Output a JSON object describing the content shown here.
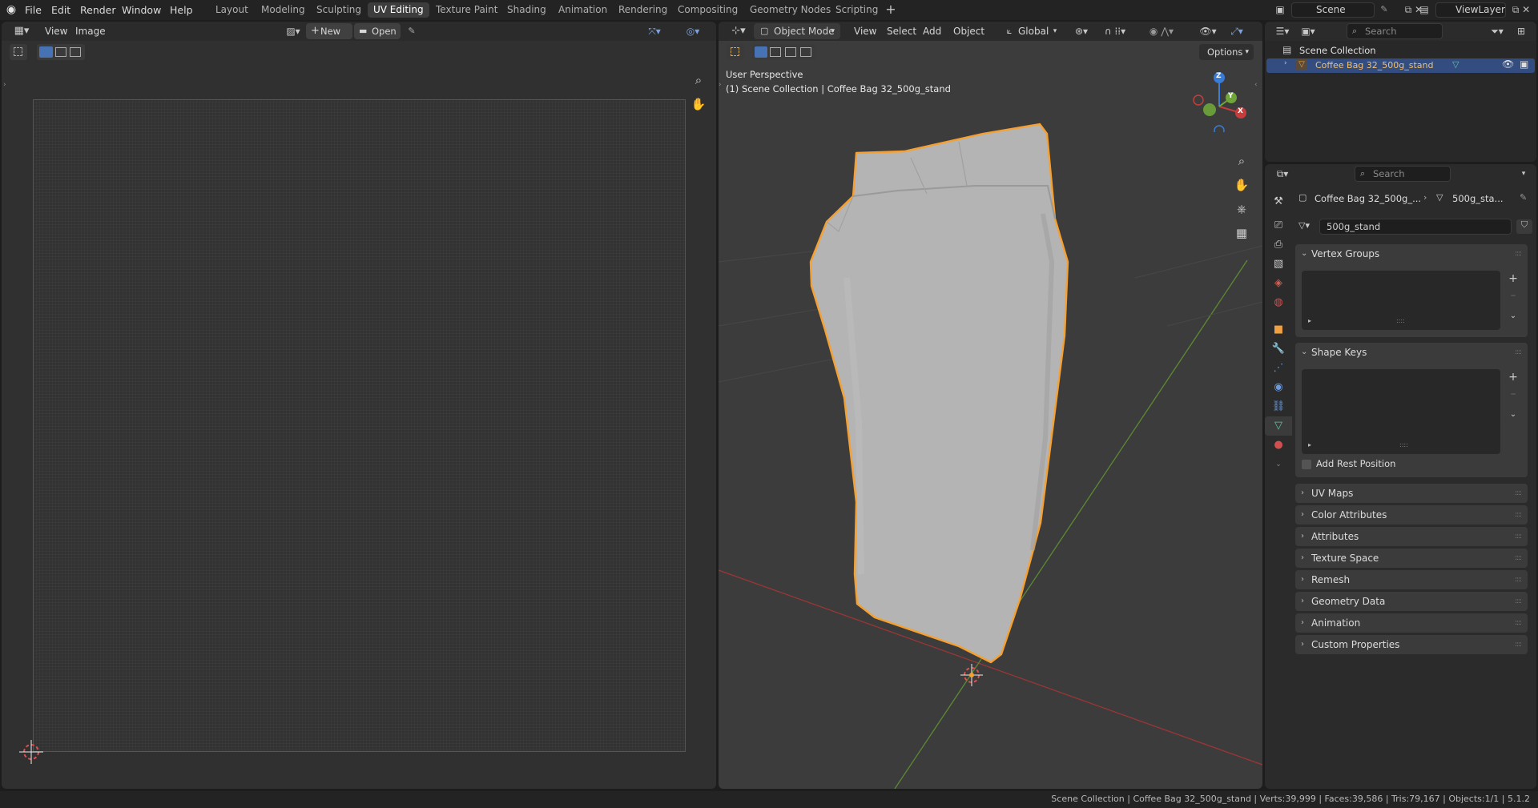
{
  "menu": {
    "file": "File",
    "edit": "Edit",
    "render": "Render",
    "window": "Window",
    "help": "Help"
  },
  "workspaces": [
    "Layout",
    "Modeling",
    "Sculpting",
    "UV Editing",
    "Texture Paint",
    "Shading",
    "Animation",
    "Rendering",
    "Compositing",
    "Geometry Nodes",
    "Scripting"
  ],
  "active_workspace": "UV Editing",
  "scene": {
    "name": "Scene",
    "view_layer": "ViewLayer"
  },
  "uv_editor": {
    "view": "View",
    "image": "Image",
    "new": "New",
    "open": "Open"
  },
  "viewport": {
    "mode": "Object Mode",
    "view": "View",
    "select": "Select",
    "add": "Add",
    "object": "Object",
    "transform": "Global",
    "options": "Options",
    "overlay_line1": "User Perspective",
    "overlay_line2": "(1) Scene Collection | Coffee Bag 32_500g_stand",
    "axis_x": "X",
    "axis_y": "Y",
    "axis_z": "Z"
  },
  "outliner": {
    "search_placeholder": "Search",
    "collection": "Scene Collection",
    "object": "Coffee Bag 32_500g_stand"
  },
  "properties": {
    "search_placeholder": "Search",
    "breadcrumb_object": "Coffee Bag 32_500g_...",
    "breadcrumb_mesh": "500g_sta...",
    "mesh_name": "500g_stand",
    "vertex_groups": "Vertex Groups",
    "shape_keys": "Shape Keys",
    "add_rest_position": "Add Rest Position",
    "sections": [
      "UV Maps",
      "Color Attributes",
      "Attributes",
      "Texture Space",
      "Remesh",
      "Geometry Data",
      "Animation",
      "Custom Properties"
    ]
  },
  "status": {
    "text": "Scene Collection | Coffee Bag 32_500g_stand | Verts:39,999 | Faces:39,586 | Tris:79,167 | Objects:1/1 | 5.1.2"
  },
  "colors": {
    "accent": "#4772b3",
    "selection": "#f0a040",
    "x_axis": "#c83c3c",
    "y_axis": "#6fa53a",
    "z_axis": "#3a7bd5"
  }
}
